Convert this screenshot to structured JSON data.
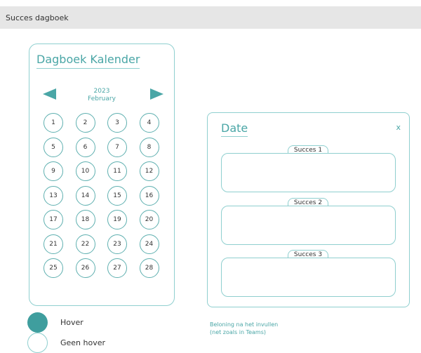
{
  "window": {
    "title": "Succes dagboek"
  },
  "calendar": {
    "title": "Dagboek Kalender",
    "year": "2023",
    "month": "February",
    "days": [
      "1",
      "2",
      "3",
      "4",
      "5",
      "6",
      "7",
      "8",
      "9",
      "10",
      "11",
      "12",
      "13",
      "14",
      "15",
      "16",
      "17",
      "18",
      "19",
      "20",
      "21",
      "22",
      "23",
      "24",
      "25",
      "26",
      "27",
      "28"
    ]
  },
  "date_panel": {
    "title": "Date",
    "close": "x",
    "sections": [
      {
        "label": "Succes 1"
      },
      {
        "label": "Succes 2"
      },
      {
        "label": "Succes 3"
      }
    ]
  },
  "note": {
    "line1": "Beloning na het invullen",
    "line2": "(net zoals in Teams)"
  },
  "legend": {
    "hover": "Hover",
    "no_hover": "Geen hover"
  },
  "colors": {
    "accent": "#4aa6a6",
    "border": "#8fcfcf",
    "fill": "#3f9e9e",
    "topbar": "#e6e6e6"
  },
  "icons": {
    "prev": "triangle-left-icon",
    "next": "triangle-right-icon"
  }
}
